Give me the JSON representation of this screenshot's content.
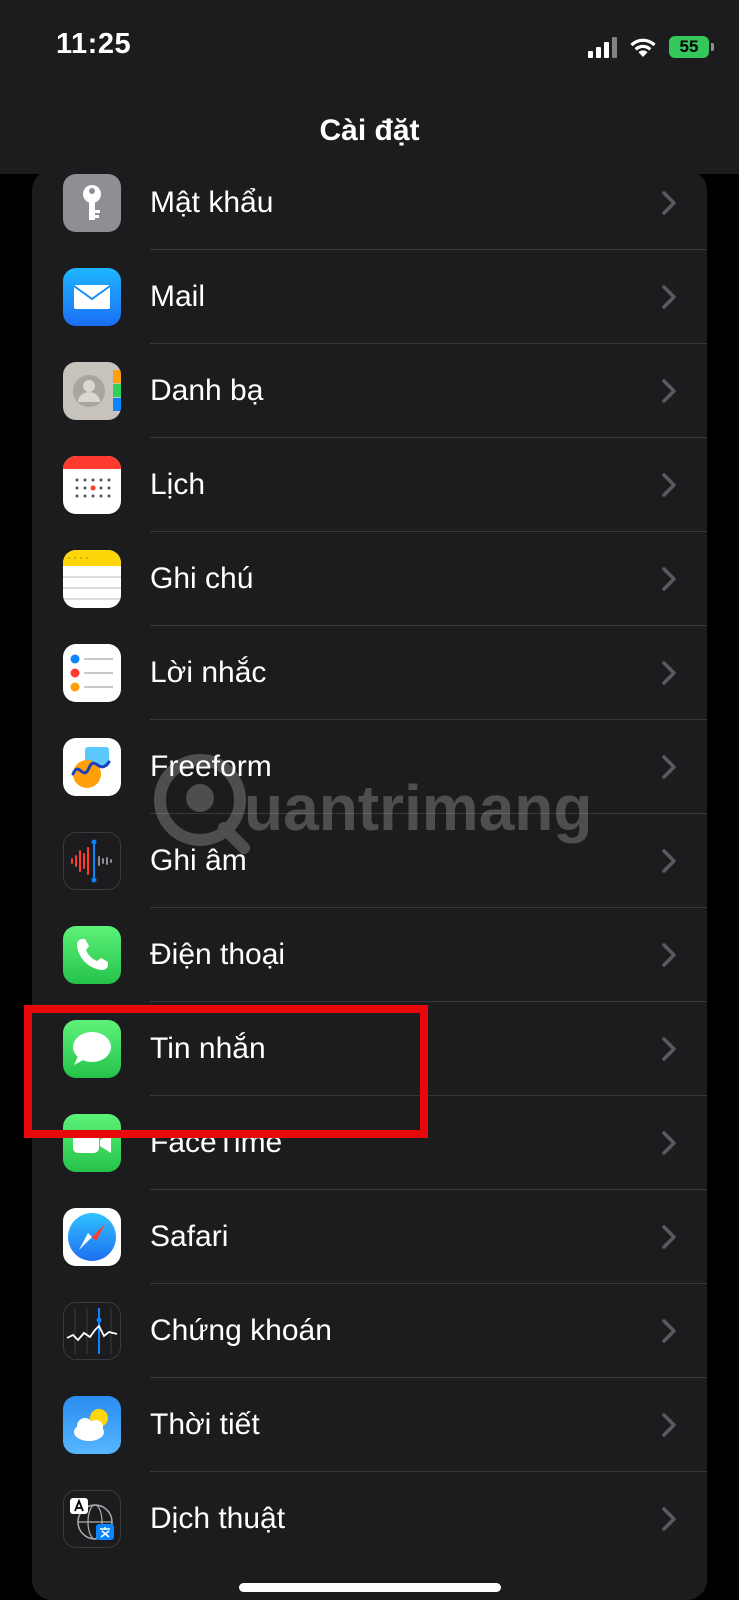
{
  "status_bar": {
    "time": "11:25",
    "battery": "55"
  },
  "nav": {
    "title": "Cài đặt"
  },
  "settings_items": [
    {
      "label": "Mật khẩu",
      "icon": "key-icon"
    },
    {
      "label": "Mail",
      "icon": "mail-icon"
    },
    {
      "label": "Danh bạ",
      "icon": "contacts-icon"
    },
    {
      "label": "Lịch",
      "icon": "calendar-icon"
    },
    {
      "label": "Ghi chú",
      "icon": "notes-icon"
    },
    {
      "label": "Lời nhắc",
      "icon": "reminders-icon"
    },
    {
      "label": "Freeform",
      "icon": "freeform-icon"
    },
    {
      "label": "Ghi âm",
      "icon": "voice-memos-icon"
    },
    {
      "label": "Điện thoại",
      "icon": "phone-icon"
    },
    {
      "label": "Tin nhắn",
      "icon": "messages-icon",
      "highlighted": true
    },
    {
      "label": "FaceTime",
      "icon": "facetime-icon"
    },
    {
      "label": "Safari",
      "icon": "safari-icon"
    },
    {
      "label": "Chứng khoán",
      "icon": "stocks-icon"
    },
    {
      "label": "Thời tiết",
      "icon": "weather-icon"
    },
    {
      "label": "Dịch thuật",
      "icon": "translate-icon"
    }
  ],
  "watermark": {
    "text": "Quantrimang"
  },
  "colors": {
    "highlight_border": "#e8080b",
    "battery_fill": "#34c759",
    "group_bg": "#1c1c1e"
  }
}
